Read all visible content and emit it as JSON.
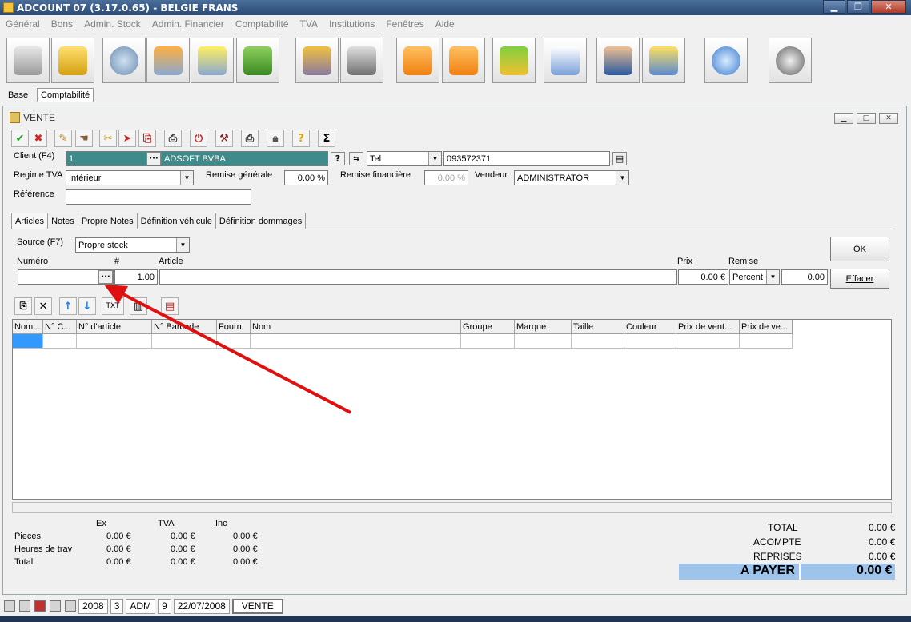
{
  "app": {
    "title": "ADCOUNT 07 (3.17.0.65)  - BELGIE FRANS"
  },
  "menu": [
    "Général",
    "Bons",
    "Admin. Stock",
    "Admin. Financier",
    "Comptabilité",
    "TVA",
    "Institutions",
    "Fenêtres",
    "Aide"
  ],
  "toolbar_icons": [
    "cart-icon",
    "coins-icon",
    "gear-icon",
    "settings-monitor-icon",
    "monitor-bulb-icon",
    "book-icon",
    "document-box-icon",
    "keys-icon",
    "download-arrow-icon",
    "upload-arrow-icon",
    "import-arrows-icon",
    "window-download-icon",
    "user-icon",
    "truck-icon",
    "lightbulb-icon",
    "disk-key-icon"
  ],
  "main_tabs": [
    "Base",
    "Comptabilité"
  ],
  "window": {
    "title": "VENTE"
  },
  "form": {
    "client_label": "Client (F4)",
    "client_code": "1",
    "client_name": "ADSOFT BVBA",
    "contact_type": "Tel",
    "contact_value": "093572371",
    "regime_label": "Regime TVA",
    "regime_value": "Intérieur",
    "remise_gen_label": "Remise générale",
    "remise_gen_value": "0.00 %",
    "remise_fin_label": "Remise financière",
    "remise_fin_value": "0.00 %",
    "vendeur_label": "Vendeur",
    "vendeur_value": "ADMINISTRATOR",
    "reference_label": "Référence",
    "reference_value": ""
  },
  "sub_tabs": [
    "Articles",
    "Notes",
    "Propre Notes",
    "Définition véhicule",
    "Définition dommages"
  ],
  "entry": {
    "source_label": "Source (F7)",
    "source_value": "Propre stock",
    "numero_label": "Numéro",
    "qty_label": "#",
    "article_label": "Article",
    "prix_label": "Prix",
    "remise_label": "Remise",
    "numero_value": "",
    "qty_value": "1.00",
    "article_value": "",
    "prix_value": "0.00 €",
    "remise_type": "Percent",
    "remise_value": "0.00",
    "ok_label": "OK",
    "effacer_label": "Effacer",
    "txt_label": "TXT"
  },
  "grid": {
    "columns": [
      "Nom...",
      "N° C...",
      "N° d'article",
      "N° Barcode",
      "Fourn.",
      "Nom",
      "Groupe",
      "Marque",
      "Taille",
      "Couleur",
      "Prix de vent...",
      "Prix de ve..."
    ]
  },
  "summary": {
    "headers": [
      "Ex",
      "TVA",
      "Inc"
    ],
    "rows": [
      {
        "label": "Pieces",
        "ex": "0.00 €",
        "tva": "0.00 €",
        "inc": "0.00 €"
      },
      {
        "label": "Heures de trav",
        "ex": "0.00 €",
        "tva": "0.00 €",
        "inc": "0.00 €"
      },
      {
        "label": "Total",
        "ex": "0.00 €",
        "tva": "0.00 €",
        "inc": "0.00 €"
      }
    ]
  },
  "totals": {
    "total_label": "TOTAL",
    "total_value": "0.00 €",
    "acompte_label": "ACOMPTE",
    "acompte_value": "0.00 €",
    "reprises_label": "REPRISES",
    "reprises_value": "0.00 €",
    "payer_label": "A PAYER",
    "payer_value": "0.00 €"
  },
  "status": {
    "year": "2008",
    "period": "3",
    "user": "ADM",
    "num": "9",
    "date": "22/07/2008",
    "window": "VENTE"
  },
  "colors": {
    "accent": "#3f8b8b",
    "payer_bg": "#9ec4ec",
    "arrow": "#e01010"
  }
}
